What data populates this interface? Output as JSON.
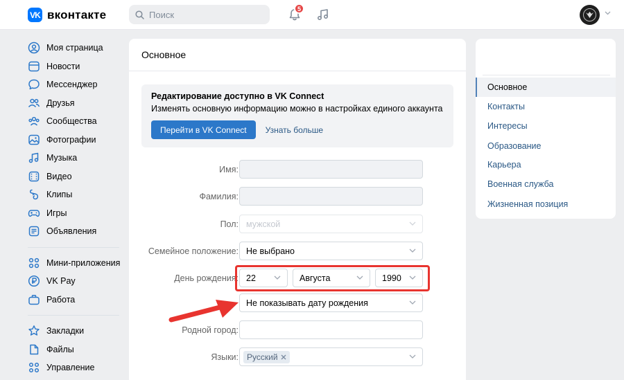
{
  "header": {
    "logo_text": "вконтакте",
    "logo_mark": "VK",
    "search_placeholder": "Поиск",
    "notifications_count": "5"
  },
  "left_menu": {
    "group1": [
      {
        "label": "Моя страница",
        "icon": "user-circle-icon"
      },
      {
        "label": "Новости",
        "icon": "news-icon"
      },
      {
        "label": "Мессенджер",
        "icon": "message-icon"
      },
      {
        "label": "Друзья",
        "icon": "friends-icon"
      },
      {
        "label": "Сообщества",
        "icon": "communities-icon"
      },
      {
        "label": "Фотографии",
        "icon": "photo-icon"
      },
      {
        "label": "Музыка",
        "icon": "music-icon"
      },
      {
        "label": "Видео",
        "icon": "video-icon"
      },
      {
        "label": "Клипы",
        "icon": "clips-icon"
      },
      {
        "label": "Игры",
        "icon": "gamepad-icon"
      },
      {
        "label": "Объявления",
        "icon": "ads-icon"
      }
    ],
    "group2": [
      {
        "label": "Мини-приложения",
        "icon": "apps-icon"
      },
      {
        "label": "VK Pay",
        "icon": "vkpay-icon"
      },
      {
        "label": "Работа",
        "icon": "briefcase-icon"
      }
    ],
    "group3": [
      {
        "label": "Закладки",
        "icon": "star-icon"
      },
      {
        "label": "Файлы",
        "icon": "file-icon"
      },
      {
        "label": "Управление",
        "icon": "manage-icon"
      }
    ]
  },
  "main": {
    "title": "Основное",
    "connect": {
      "title": "Редактирование доступно в VK Connect",
      "description": "Изменять основную информацию можно в настройках единого аккаунта",
      "button": "Перейти в VK Connect",
      "link": "Узнать больше"
    },
    "form": {
      "first_name_label": "Имя:",
      "first_name_value": "",
      "last_name_label": "Фамилия:",
      "last_name_value": "",
      "gender_label": "Пол:",
      "gender_value": "мужской",
      "marital_label": "Семейное положение:",
      "marital_value": "Не выбрано",
      "birthday_label": "День рождения:",
      "birthday_day": "22",
      "birthday_month": "Августа",
      "birthday_year": "1990",
      "birthday_visibility": "Не показывать дату рождения",
      "hometown_label": "Родной город:",
      "hometown_value": "",
      "languages_label": "Языки:",
      "languages_tag": "Русский"
    }
  },
  "right_nav": {
    "items": [
      {
        "label": "Основное",
        "active": true
      },
      {
        "label": "Контакты"
      },
      {
        "label": "Интересы"
      },
      {
        "label": "Образование"
      },
      {
        "label": "Карьера"
      },
      {
        "label": "Военная служба"
      },
      {
        "label": "Жизненная позиция"
      }
    ]
  },
  "colors": {
    "accent": "#2c78c9",
    "link": "#2a5885",
    "highlight": "#e8342f",
    "badge": "#e64646",
    "logo": "#0077ff"
  }
}
